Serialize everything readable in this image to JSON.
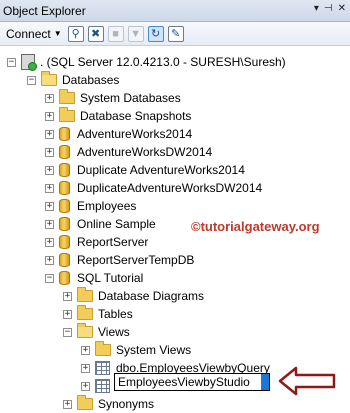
{
  "window": {
    "title": "Object Explorer",
    "pin_icon": "pin-icon",
    "close_icon": "close-icon"
  },
  "toolbar": {
    "connect_label": "Connect",
    "buttons": [
      "connect-icon",
      "disconnect-icon",
      "stop-icon",
      "filter-icon",
      "refresh-icon",
      "summary-icon"
    ]
  },
  "tree": {
    "server": ". (SQL Server 12.0.4213.0 - SURESH\\Suresh)",
    "databases": "Databases",
    "system_databases": "System Databases",
    "database_snapshots": "Database Snapshots",
    "db_items": [
      "AdventureWorks2014",
      "AdventureWorksDW2014",
      "Duplicate AdventureWorks2014",
      "DuplicateAdventureWorksDW2014",
      "Employees",
      "Online Sample",
      "ReportServer",
      "ReportServerTempDB",
      "SQL Tutorial"
    ],
    "sql_tutorial_children": {
      "diagrams": "Database Diagrams",
      "tables": "Tables",
      "views": "Views",
      "system_views": "System Views",
      "view1": "dbo.EmployeesViewbyQuery",
      "view2_edit": "EmployeesViewbyStudio",
      "synonyms": "Synonyms"
    }
  },
  "watermark": "©tutorialgateway.org",
  "colors": {
    "folder": "#f3cd5a",
    "database": "#e8b83a",
    "watermark": "#c0392b",
    "arrow": "#8b1a1a"
  }
}
